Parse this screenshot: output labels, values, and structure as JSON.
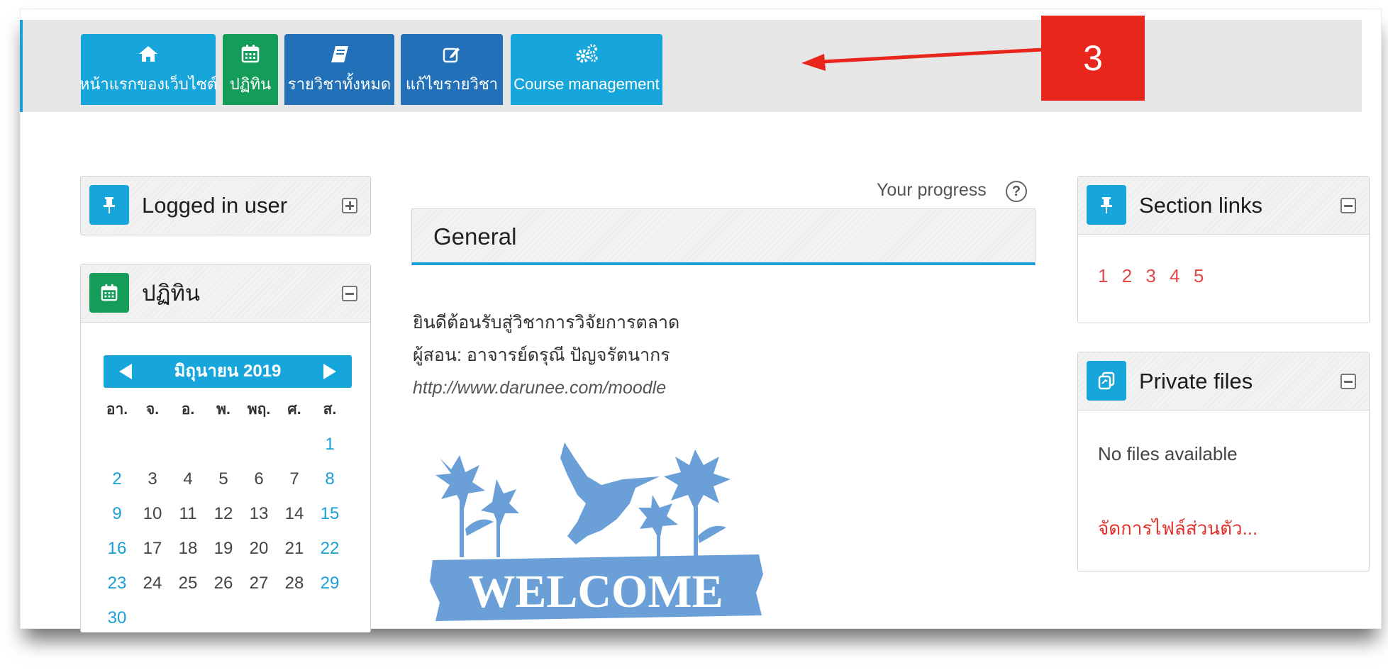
{
  "nav": {
    "buttons": [
      {
        "label": "หน้าแรกของเว็บไซต์",
        "icon": "home-icon"
      },
      {
        "label": "ปฏิทิน",
        "icon": "calendar-icon"
      },
      {
        "label": "รายวิชาทั้งหมด",
        "icon": "book-icon"
      },
      {
        "label": "แก้ไขรายวิชา",
        "icon": "edit-icon"
      },
      {
        "label": "Course management",
        "icon": "cogs-icon"
      }
    ]
  },
  "annotation": {
    "label": "3",
    "color": "#e8261c"
  },
  "blocks": {
    "logged_in": {
      "title": "Logged in user",
      "icon": "pin-icon"
    },
    "calendar": {
      "title": "ปฏิทิน",
      "icon": "calendar-icon",
      "month": "มิถุนายน 2019",
      "weekdays": [
        "อา.",
        "จ.",
        "อ.",
        "พ.",
        "พฤ.",
        "ศ.",
        "ส."
      ],
      "weeks": [
        [
          "",
          "",
          "",
          "",
          "",
          "",
          "1"
        ],
        [
          "2",
          "3",
          "4",
          "5",
          "6",
          "7",
          "8"
        ],
        [
          "9",
          "10",
          "11",
          "12",
          "13",
          "14",
          "15"
        ],
        [
          "16",
          "17",
          "18",
          "19",
          "20",
          "21",
          "22"
        ],
        [
          "23",
          "24",
          "25",
          "26",
          "27",
          "28",
          "29"
        ],
        [
          "30",
          "",
          "",
          "",
          "",
          "",
          ""
        ]
      ],
      "event_days": [
        "12",
        "13",
        "15",
        "18",
        "19",
        "20"
      ],
      "today": "17"
    },
    "section_links": {
      "title": "Section links",
      "icon": "pin-icon",
      "links": [
        "1",
        "2",
        "3",
        "4",
        "5"
      ]
    },
    "private_files": {
      "title": "Private files",
      "icon": "files-icon",
      "empty_text": "No files available",
      "manage_link": "จัดการไฟล์ส่วนตัว..."
    }
  },
  "main": {
    "progress_label": "Your progress",
    "section_title": "General",
    "summary_lines": [
      "ยินดีต้อนรับสู่วิชาการวิจัยการตลาด",
      "ผู้สอน: อาจารย์ดรุณี  ปัญจรัตนากร"
    ],
    "summary_url": "http://www.darunee.com/moodle",
    "welcome_text": "WELCOME"
  },
  "colors": {
    "cyan": "#17a6db",
    "green": "#139d58",
    "blue": "#2271b8",
    "link_red": "#e24a4a",
    "event": "#f7c493",
    "welcome": "#6a9fd8"
  }
}
